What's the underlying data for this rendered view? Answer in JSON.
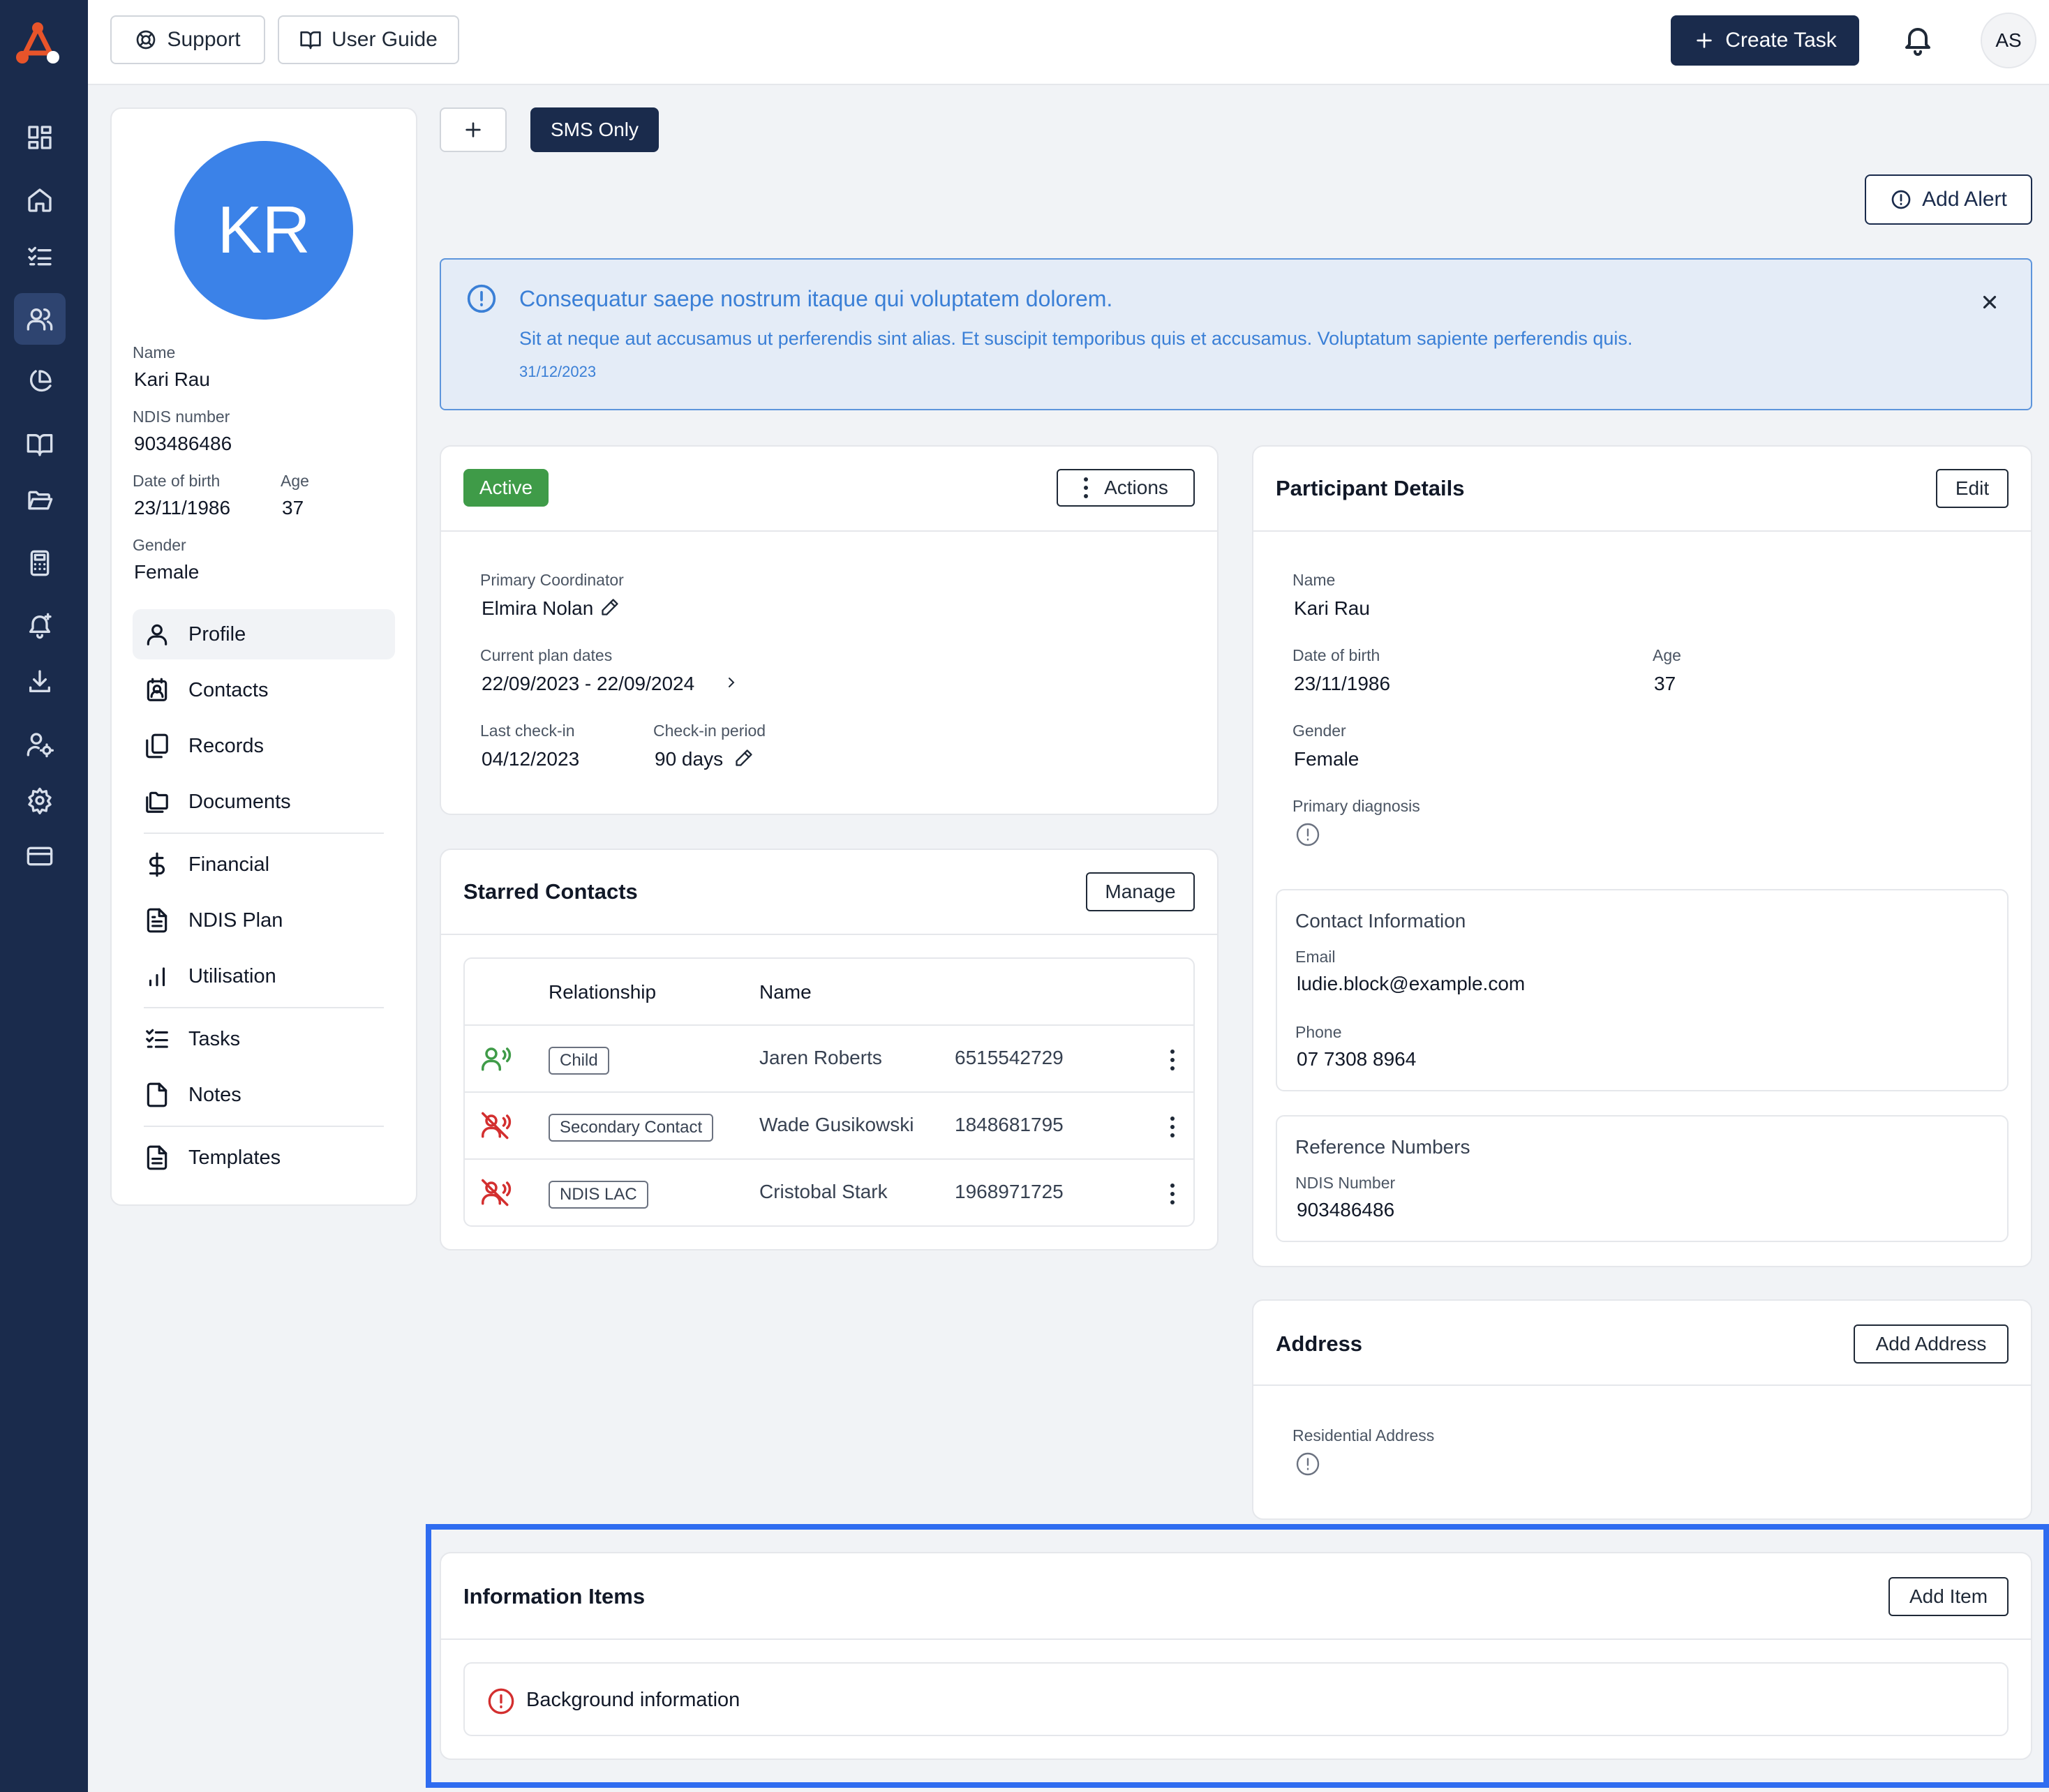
{
  "header": {
    "support_label": "Support",
    "user_guide_label": "User Guide",
    "create_task_label": "Create Task",
    "user_initials": "AS"
  },
  "profile": {
    "initials": "KR",
    "name_label": "Name",
    "name": "Kari Rau",
    "ndis_label": "NDIS number",
    "ndis": "903486486",
    "dob_label": "Date of birth",
    "dob": "23/11/1986",
    "age_label": "Age",
    "age": "37",
    "gender_label": "Gender",
    "gender": "Female",
    "menu": {
      "profile": "Profile",
      "contacts": "Contacts",
      "records": "Records",
      "documents": "Documents",
      "financial": "Financial",
      "ndis_plan": "NDIS Plan",
      "utilisation": "Utilisation",
      "tasks": "Tasks",
      "notes": "Notes",
      "templates": "Templates"
    }
  },
  "toolbar": {
    "sms_only_label": "SMS Only",
    "add_alert_label": "Add Alert"
  },
  "alert": {
    "title": "Consequatur saepe nostrum itaque qui voluptatem dolorem.",
    "body": "Sit at neque aut accusamus ut perferendis sint alias. Et suscipit temporibus quis et accusamus. Voluptatum sapiente perferendis quis.",
    "date": "31/12/2023"
  },
  "status_card": {
    "status": "Active",
    "actions_label": "Actions",
    "coordinator_label": "Primary Coordinator",
    "coordinator": "Elmira Nolan",
    "plan_dates_label": "Current plan dates",
    "plan_dates": "22/09/2023 - 22/09/2024",
    "last_checkin_label": "Last check-in",
    "last_checkin": "04/12/2023",
    "checkin_period_label": "Check-in period",
    "checkin_period": "90 days"
  },
  "starred_contacts": {
    "title": "Starred Contacts",
    "manage_label": "Manage",
    "col_relationship": "Relationship",
    "col_name": "Name",
    "rows": [
      {
        "relationship": "Child",
        "name": "Jaren Roberts",
        "phone": "6515542729",
        "status": "active"
      },
      {
        "relationship": "Secondary Contact",
        "name": "Wade Gusikowski",
        "phone": "1848681795",
        "status": "muted"
      },
      {
        "relationship": "NDIS LAC",
        "name": "Cristobal Stark",
        "phone": "1968971725",
        "status": "muted"
      }
    ]
  },
  "participant_details": {
    "title": "Participant Details",
    "edit_label": "Edit",
    "name_label": "Name",
    "name": "Kari Rau",
    "dob_label": "Date of birth",
    "dob": "23/11/1986",
    "age_label": "Age",
    "age": "37",
    "gender_label": "Gender",
    "gender": "Female",
    "diagnosis_label": "Primary diagnosis",
    "contact_info": {
      "title": "Contact Information",
      "email_label": "Email",
      "email": "ludie.block@example.com",
      "phone_label": "Phone",
      "phone": "07 7308 8964"
    },
    "reference": {
      "title": "Reference Numbers",
      "ndis_label": "NDIS Number",
      "ndis": "903486486"
    }
  },
  "address": {
    "title": "Address",
    "add_label": "Add Address",
    "residential_label": "Residential Address"
  },
  "information_items": {
    "title": "Information Items",
    "add_label": "Add Item",
    "items": [
      "Background information"
    ]
  },
  "colors": {
    "sidebar": "#1a2b4c",
    "accent": "#3b82e8",
    "active_badge": "#3f9b48",
    "alert_bg": "#e4ecf7",
    "alert_text": "#3a7fd6",
    "danger": "#d32f2f",
    "highlight": "#2f6cf0"
  }
}
